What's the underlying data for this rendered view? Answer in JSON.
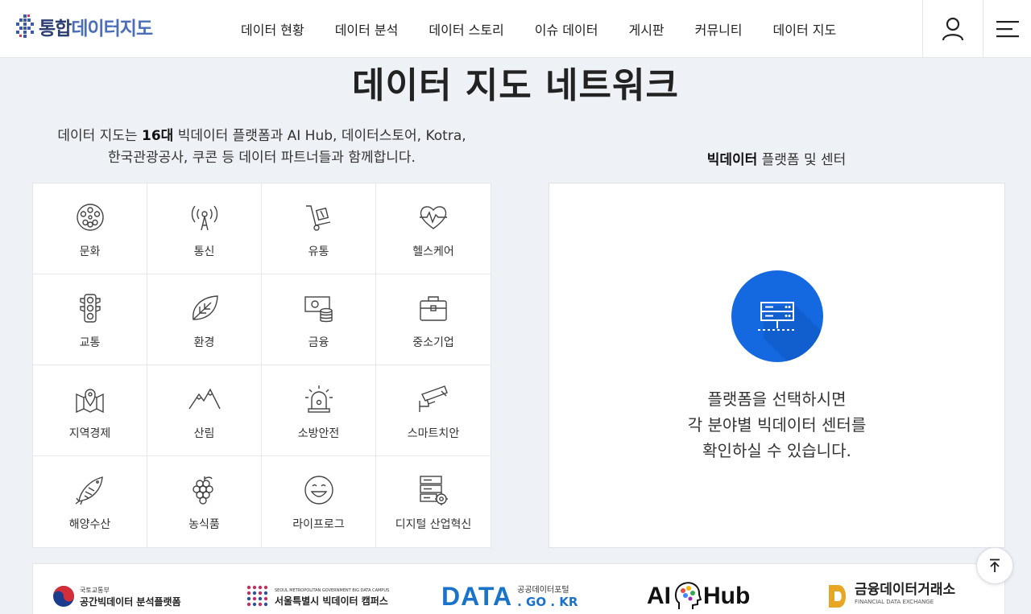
{
  "header": {
    "logo_main": "통합",
    "logo_sub": "데이터지도",
    "nav": [
      "데이터 현황",
      "데이터 분석",
      "데이터 스토리",
      "이슈 데이터",
      "게시판",
      "커뮤니티",
      "데이터 지도"
    ],
    "user_icon": "user-icon",
    "menu_icon": "hamburger-menu-icon"
  },
  "page": {
    "title": "데이터 지도 네트워크",
    "intro_line1_pre": "데이터 지도는 ",
    "intro_line1_bold": "16대",
    "intro_line1_post": " 빅데이터 플랫폼과 AI Hub, 데이터스토어, Kotra,",
    "intro_line2": "한국관광공사, 쿠콘 등 데이터 파트너들과 함께합니다.",
    "panel_title_bold": "빅데이터",
    "panel_title_rest": " 플랫폼 및 센터"
  },
  "platforms": [
    {
      "label": "문화",
      "icon": "film-reel-icon"
    },
    {
      "label": "통신",
      "icon": "broadcast-icon"
    },
    {
      "label": "유통",
      "icon": "hand-truck-icon"
    },
    {
      "label": "헬스케어",
      "icon": "heart-pulse-icon"
    },
    {
      "label": "교통",
      "icon": "traffic-light-icon"
    },
    {
      "label": "환경",
      "icon": "leaf-icon"
    },
    {
      "label": "금융",
      "icon": "money-coins-icon"
    },
    {
      "label": "중소기업",
      "icon": "briefcase-icon"
    },
    {
      "label": "지역경제",
      "icon": "map-pin-icon"
    },
    {
      "label": "산림",
      "icon": "mountain-icon"
    },
    {
      "label": "소방안전",
      "icon": "siren-icon"
    },
    {
      "label": "스마트치안",
      "icon": "cctv-camera-icon"
    },
    {
      "label": "해양수산",
      "icon": "fish-icon"
    },
    {
      "label": "농식품",
      "icon": "grapes-icon"
    },
    {
      "label": "라이프로그",
      "icon": "smile-face-icon"
    },
    {
      "label": "디지털 산업혁신",
      "icon": "server-gear-icon"
    }
  ],
  "info": {
    "icon": "server-network-icon",
    "line1": "플랫폼을 선택하시면",
    "line2": "각 분야별 빅데이터 센터를",
    "line3": "확인하실 수 있습니다."
  },
  "partners": {
    "molit_small": "국토교통부",
    "molit_name": "공간빅데이터 분석플랫폼",
    "seoul_small": "SEOUL METROPOLITAN GOVERNMENT BIG DATA CAMPUS",
    "seoul_name": "서울특별시 빅데이터 캠퍼스",
    "data_main": "DATA",
    "data_small": "공공데이터포털",
    "data_domain": ". GO . KR",
    "aihub_ai": "AI",
    "aihub_hub": "Hub",
    "fin_name": "금융데이터거래소",
    "fin_small": "FINANCIAL DATA EXCHANGE"
  },
  "colors": {
    "accent_blue": "#1469e0",
    "logo_navy": "#2c3e73",
    "data_blue": "#1a73c9",
    "fin_gold": "#e7a623"
  }
}
